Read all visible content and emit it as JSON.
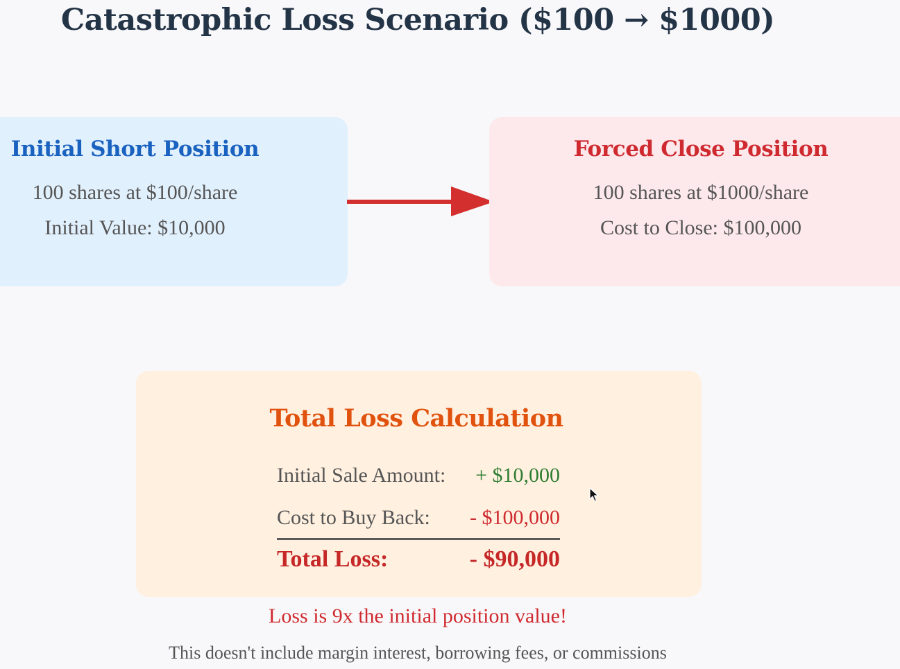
{
  "title": "Catastrophic Loss Scenario ($100 → $1000)",
  "initial_position": {
    "heading": "Initial Short Position",
    "shares_line": "100 shares at $100/share",
    "value_line": "Initial Value: $10,000"
  },
  "forced_close": {
    "heading": "Forced Close Position",
    "shares_line": "100 shares at $1000/share",
    "cost_line": "Cost to Close: $100,000"
  },
  "calculation": {
    "heading": "Total Loss Calculation",
    "sale_label": "Initial Sale Amount:",
    "sale_value": "+ $10,000",
    "buyback_label": "Cost to Buy Back:",
    "buyback_value": "- $100,000",
    "total_label": "Total Loss:",
    "total_value": "- $90,000"
  },
  "warning": "Loss is 9x the initial position value!",
  "note": "This doesn't include margin interest, borrowing fees, or commissions",
  "colors": {
    "initial_box": "#e1f0fd",
    "initial_heading": "#1a62c0",
    "forced_box": "#fde9ec",
    "forced_heading": "#cf2a2f",
    "calc_box": "#fff0e0",
    "calc_heading": "#e0520e",
    "gain": "#2e7d32",
    "loss": "#c62828",
    "arrow": "#d32f2f"
  },
  "icons": {
    "flow_arrow": "right-arrow-icon",
    "cursor": "mouse-pointer-icon"
  }
}
